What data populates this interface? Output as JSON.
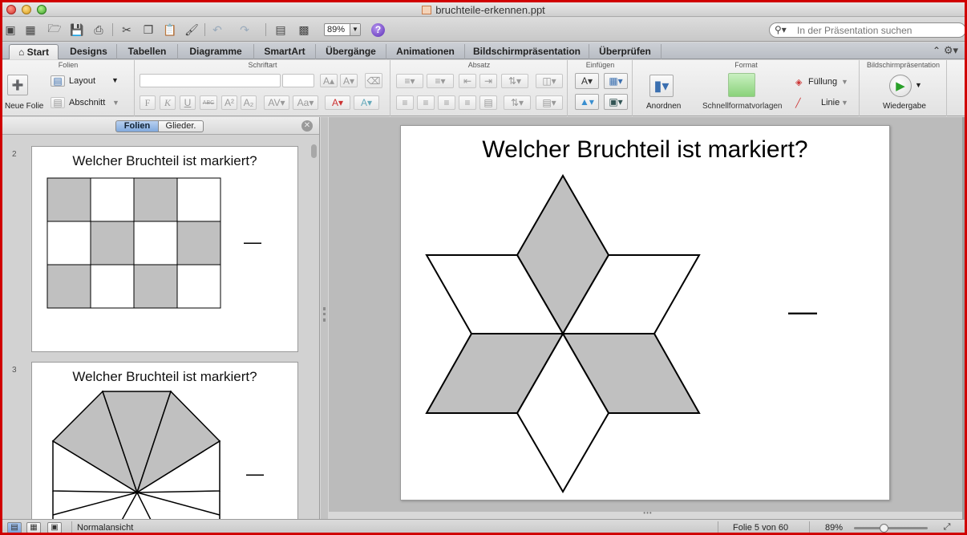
{
  "window": {
    "title": "bruchteile-erkennen.ppt"
  },
  "toolbar": {
    "zoom_value": "89%",
    "search_placeholder": "In der Präsentation suchen",
    "help_glyph": "?"
  },
  "ribbon_tabs": [
    "Start",
    "Designs",
    "Tabellen",
    "Diagramme",
    "SmartArt",
    "Übergänge",
    "Animationen",
    "Bildschirmpräsentation",
    "Überprüfen"
  ],
  "ribbon": {
    "groups": {
      "folien": "Folien",
      "schriftart": "Schriftart",
      "absatz": "Absatz",
      "einfuegen": "Einfügen",
      "format": "Format",
      "praesentation": "Bildschirmpräsentation"
    },
    "neue_folie": "Neue Folie",
    "layout": "Layout",
    "abschnitt": "Abschnitt",
    "font_buttons": [
      "F",
      "K",
      "U",
      "ABC",
      "A²",
      "A₂"
    ],
    "anordnen": "Anordnen",
    "schnellformatvorlagen": "Schnellformatvorlagen",
    "fuellung": "Füllung",
    "linie": "Linie",
    "wiedergabe": "Wiedergabe"
  },
  "left_pane": {
    "segment_slides": "Folien",
    "segment_outline": "Glieder.",
    "thumbnails": [
      {
        "number": "2",
        "title": "Welcher Bruchteil ist markiert?",
        "answer": "—"
      },
      {
        "number": "3",
        "title": "Welcher Bruchteil ist markiert?",
        "answer": "—"
      }
    ]
  },
  "slide": {
    "title": "Welcher Bruchteil ist markiert?",
    "answer": "—",
    "star_shaded_pieces": 3,
    "star_total_pieces": 6
  },
  "thumb2_grid": {
    "rows": 3,
    "cols": 4,
    "shaded": [
      [
        1,
        0,
        1,
        0
      ],
      [
        0,
        1,
        0,
        1
      ],
      [
        1,
        0,
        1,
        0
      ]
    ]
  },
  "thumb3_octagon": {
    "shaded_visible": 3
  },
  "statusbar": {
    "view_mode": "Normalansicht",
    "slide_position": "Folie 5 von 60",
    "zoom": "89%",
    "zoom_level": 0.4
  },
  "colors": {
    "shape_fill": "#c0c0c0",
    "window_border": "#d00000"
  }
}
